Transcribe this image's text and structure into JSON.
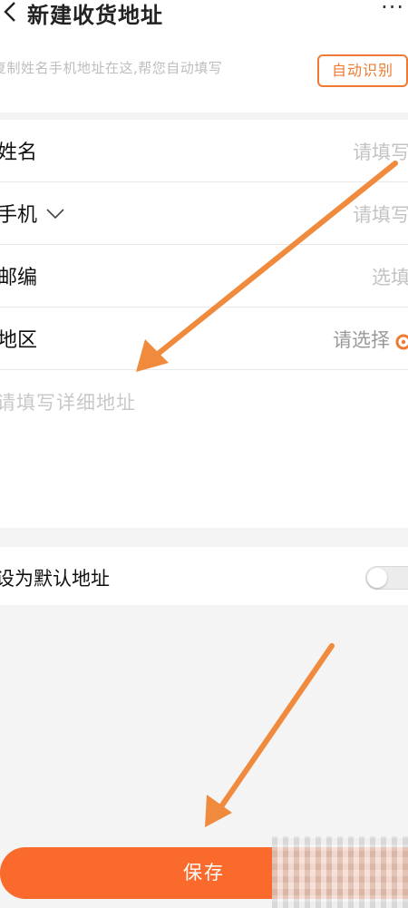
{
  "header": {
    "title": "新建收货地址",
    "more": "···"
  },
  "paste": {
    "hint": "复制姓名手机地址在这,帮您自动填写",
    "auto_button": "自动识别"
  },
  "form": {
    "name": {
      "label": "姓名",
      "placeholder": "请填写"
    },
    "phone": {
      "label": "手机",
      "placeholder": "请填写"
    },
    "postcode": {
      "label": "邮编",
      "placeholder": "选填"
    },
    "region": {
      "label": "地区",
      "placeholder": "请选择"
    },
    "detail": {
      "placeholder": "请填写详细地址"
    }
  },
  "default_address": {
    "label": "设为默认地址",
    "enabled": false
  },
  "save_button": "保存",
  "colors": {
    "accent": "#fa6a2c",
    "annotation_arrow": "#f08a3c",
    "placeholder": "#c3c3c3"
  }
}
